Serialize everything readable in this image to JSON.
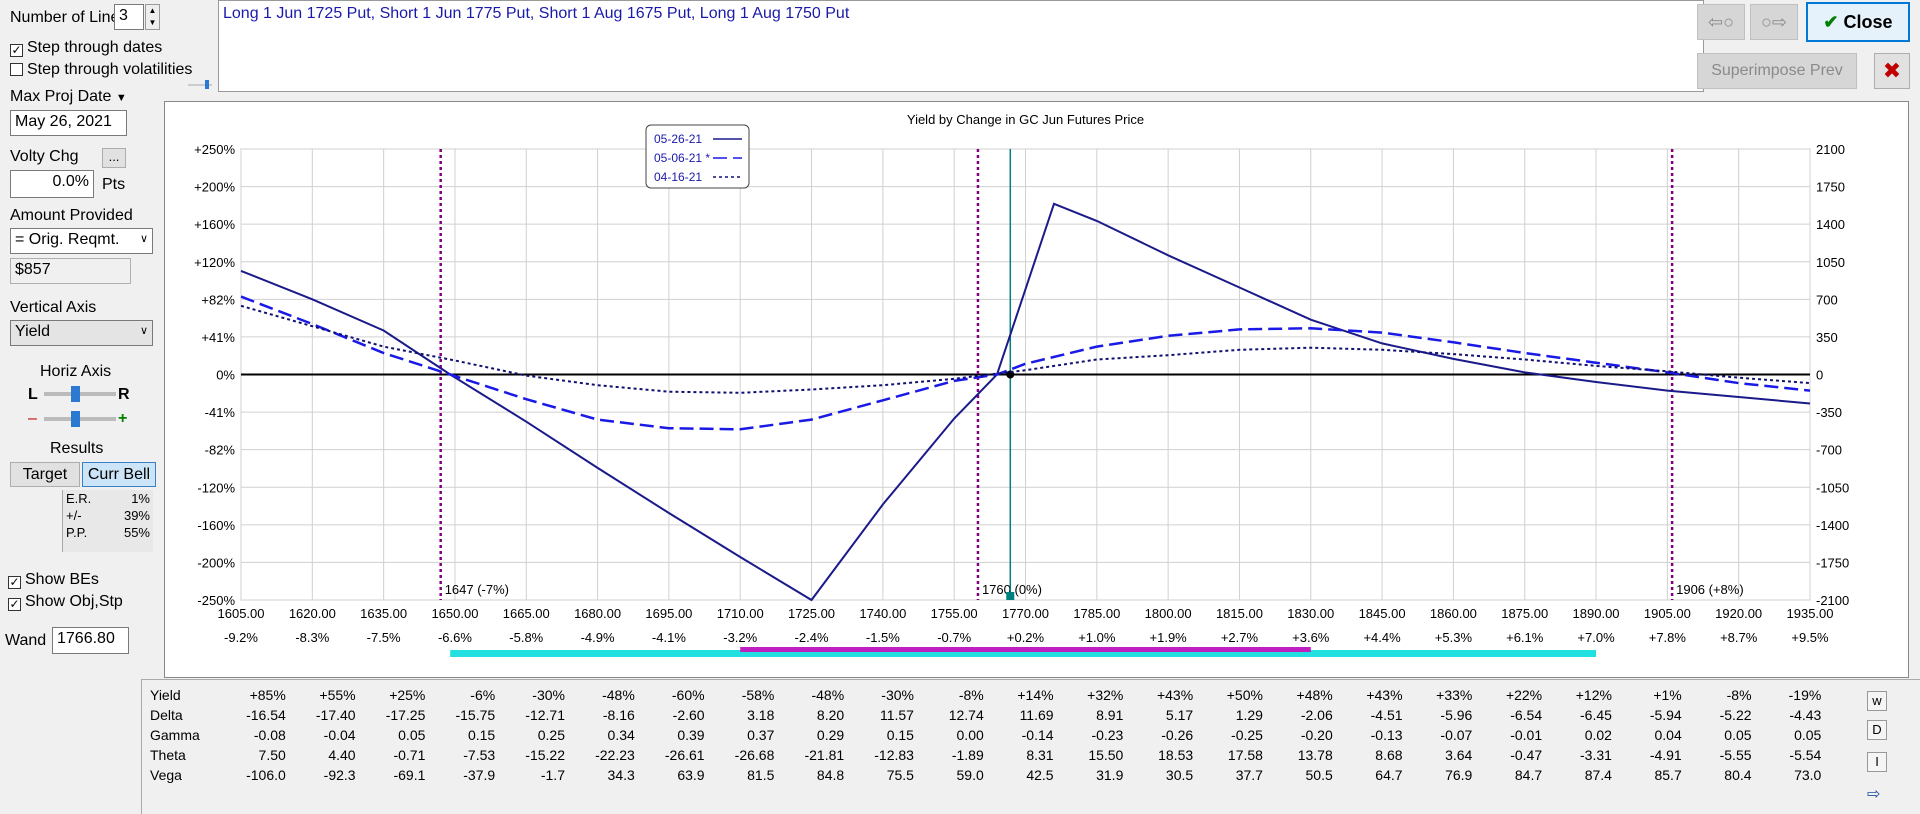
{
  "controls": {
    "number_of_lines_label": "Number of Lines",
    "number_of_lines_value": "3",
    "step_dates_label": "Step through dates",
    "step_dates_checked": true,
    "step_vol_label": "Step through volatilities",
    "step_vol_checked": false,
    "max_proj_date_label": "Max Proj Date",
    "max_proj_date_value": "May 26, 2021",
    "volty_chg_label": "Volty Chg",
    "volty_chg_value": "0.0%",
    "volty_chg_unit": "Pts",
    "ellipsis_label": "...",
    "amount_provided_label": "Amount Provided",
    "amount_provided_value": "= Orig. Reqmt.",
    "amount_value": "$857",
    "vertical_axis_label": "Vertical Axis",
    "vertical_axis_value": "Yield",
    "horiz_axis_label": "Horiz Axis",
    "slider_left": "L",
    "slider_right": "R",
    "slider_minus": "–",
    "slider_plus": "+",
    "results_label": "Results",
    "target_label": "Target",
    "curr_bell_label": "Curr Bell",
    "stats": [
      {
        "name": "E.R.",
        "value": "1%"
      },
      {
        "name": "+/-",
        "value": "39%"
      },
      {
        "name": "P.P.",
        "value": "55%"
      }
    ],
    "show_bes_label": "Show BEs",
    "show_bes_checked": true,
    "show_obj_label": "Show Obj,Stp",
    "show_obj_checked": true,
    "wand_label": "Wand",
    "wand_value": "1766.80"
  },
  "description": "Long 1 Jun 1725 Put, Short 1 Jun 1775 Put, Short 1 Aug 1675 Put, Long 1 Aug 1750 Put",
  "buttons": {
    "back_icon": "⇦○",
    "fwd_icon": "○⇨",
    "close_label": "Close",
    "close_icon": "✔",
    "superimpose_label": "Superimpose Prev",
    "x_icon": "✖"
  },
  "colors": {
    "line_solid": "#1a1a8a",
    "line_dash": "#1a1ae6",
    "line_dot": "#101070",
    "vline": "#800080",
    "wand": "#008080",
    "bar_cyan": "#22e0e0",
    "bar_magenta": "#c020c0"
  },
  "chart_data": {
    "type": "line",
    "title": "Yield by Change in GC Jun Futures Price",
    "x_ticks": [
      "1605.00",
      "1620.00",
      "1635.00",
      "1650.00",
      "1665.00",
      "1680.00",
      "1695.00",
      "1710.00",
      "1725.00",
      "1740.00",
      "1755.00",
      "1770.00",
      "1785.00",
      "1800.00",
      "1815.00",
      "1830.00",
      "1845.00",
      "1860.00",
      "1875.00",
      "1890.00",
      "1905.00",
      "1920.00",
      "1935.00"
    ],
    "x_pct_ticks": [
      "-9.2%",
      "-8.3%",
      "-7.5%",
      "-6.6%",
      "-5.8%",
      "-4.9%",
      "-4.1%",
      "-3.2%",
      "-2.4%",
      "-1.5%",
      "-0.7%",
      "+0.2%",
      "+1.0%",
      "+1.9%",
      "+2.7%",
      "+3.6%",
      "+4.4%",
      "+5.3%",
      "+6.1%",
      "+7.0%",
      "+7.8%",
      "+8.7%",
      "+9.5%"
    ],
    "y_left_ticks": [
      "+250%",
      "+200%",
      "+160%",
      "+120%",
      "+82%",
      "+41%",
      "0%",
      "-41%",
      "-82%",
      "-120%",
      "-160%",
      "-200%",
      "-250%"
    ],
    "y_right_ticks": [
      "2100",
      "1750",
      "1400",
      "1050",
      "700",
      "350",
      "0",
      "-350",
      "-700",
      "-1050",
      "-1400",
      "-1750",
      "-2100"
    ],
    "xlim": [
      1605,
      1935
    ],
    "ylim": [
      -2100,
      2100
    ],
    "legend_position": "top-left",
    "series": [
      {
        "name": "05-26-21",
        "style": "solid",
        "points": [
          [
            1605,
            965
          ],
          [
            1620,
            700
          ],
          [
            1635,
            410
          ],
          [
            1649,
            0
          ],
          [
            1665,
            -440
          ],
          [
            1680,
            -870
          ],
          [
            1695,
            -1290
          ],
          [
            1710,
            -1700
          ],
          [
            1725,
            -2100
          ],
          [
            1740,
            -1210
          ],
          [
            1755,
            -410
          ],
          [
            1764,
            0
          ],
          [
            1776,
            1590
          ],
          [
            1785,
            1430
          ],
          [
            1800,
            1110
          ],
          [
            1815,
            810
          ],
          [
            1830,
            510
          ],
          [
            1845,
            290
          ],
          [
            1860,
            145
          ],
          [
            1875,
            20
          ],
          [
            1890,
            -70
          ],
          [
            1905,
            -150
          ],
          [
            1920,
            -210
          ],
          [
            1935,
            -270
          ]
        ]
      },
      {
        "name": "05-06-21 *",
        "style": "dashed",
        "points": [
          [
            1605,
            725
          ],
          [
            1620,
            470
          ],
          [
            1635,
            200
          ],
          [
            1649,
            0
          ],
          [
            1665,
            -230
          ],
          [
            1680,
            -420
          ],
          [
            1695,
            -500
          ],
          [
            1710,
            -510
          ],
          [
            1725,
            -420
          ],
          [
            1740,
            -240
          ],
          [
            1755,
            -60
          ],
          [
            1764,
            0
          ],
          [
            1770,
            100
          ],
          [
            1785,
            260
          ],
          [
            1800,
            360
          ],
          [
            1815,
            420
          ],
          [
            1830,
            430
          ],
          [
            1845,
            390
          ],
          [
            1860,
            300
          ],
          [
            1875,
            200
          ],
          [
            1890,
            110
          ],
          [
            1905,
            20
          ],
          [
            1920,
            -80
          ],
          [
            1935,
            -150
          ]
        ]
      },
      {
        "name": "04-16-21",
        "style": "dotted",
        "points": [
          [
            1605,
            640
          ],
          [
            1620,
            450
          ],
          [
            1635,
            260
          ],
          [
            1650,
            130
          ],
          [
            1665,
            -10
          ],
          [
            1680,
            -100
          ],
          [
            1695,
            -160
          ],
          [
            1710,
            -170
          ],
          [
            1725,
            -140
          ],
          [
            1740,
            -100
          ],
          [
            1755,
            -40
          ],
          [
            1770,
            40
          ],
          [
            1785,
            140
          ],
          [
            1800,
            180
          ],
          [
            1815,
            230
          ],
          [
            1830,
            250
          ],
          [
            1845,
            230
          ],
          [
            1860,
            190
          ],
          [
            1875,
            140
          ],
          [
            1890,
            80
          ],
          [
            1905,
            30
          ],
          [
            1920,
            -30
          ],
          [
            1935,
            -80
          ]
        ]
      }
    ],
    "vlines": [
      {
        "x": 1647,
        "label": "1647 (-7%)"
      },
      {
        "x": 1760,
        "label": "1760 (0%)"
      },
      {
        "x": 1906,
        "label": "1906 (+8%)"
      }
    ],
    "wand_x": 1766.8,
    "cyan_bar_range": [
      1649,
      1890
    ],
    "magenta_bar_range": [
      1710,
      1830
    ]
  },
  "table": {
    "row_labels": [
      "Yield",
      "Delta",
      "Gamma",
      "Theta",
      "Vega"
    ],
    "rows": [
      [
        "+85%",
        "+55%",
        "+25%",
        "-6%",
        "-30%",
        "-48%",
        "-60%",
        "-58%",
        "-48%",
        "-30%",
        "-8%",
        "+14%",
        "+32%",
        "+43%",
        "+50%",
        "+48%",
        "+43%",
        "+33%",
        "+22%",
        "+12%",
        "+1%",
        "-8%",
        "-19%"
      ],
      [
        "-16.54",
        "-17.40",
        "-17.25",
        "-15.75",
        "-12.71",
        "-8.16",
        "-2.60",
        "3.18",
        "8.20",
        "11.57",
        "12.74",
        "11.69",
        "8.91",
        "5.17",
        "1.29",
        "-2.06",
        "-4.51",
        "-5.96",
        "-6.54",
        "-6.45",
        "-5.94",
        "-5.22",
        "-4.43"
      ],
      [
        "-0.08",
        "-0.04",
        "0.05",
        "0.15",
        "0.25",
        "0.34",
        "0.39",
        "0.37",
        "0.29",
        "0.15",
        "0.00",
        "-0.14",
        "-0.23",
        "-0.26",
        "-0.25",
        "-0.20",
        "-0.13",
        "-0.07",
        "-0.01",
        "0.02",
        "0.04",
        "0.05",
        "0.05"
      ],
      [
        "7.50",
        "4.40",
        "-0.71",
        "-7.53",
        "-15.22",
        "-22.23",
        "-26.61",
        "-26.68",
        "-21.81",
        "-12.83",
        "-1.89",
        "8.31",
        "15.50",
        "18.53",
        "17.58",
        "13.78",
        "8.68",
        "3.64",
        "-0.47",
        "-3.31",
        "-4.91",
        "-5.55",
        "-5.54"
      ],
      [
        "-106.0",
        "-92.3",
        "-69.1",
        "-37.9",
        "-1.7",
        "34.3",
        "63.9",
        "81.5",
        "84.8",
        "75.5",
        "59.0",
        "42.5",
        "31.9",
        "30.5",
        "37.7",
        "50.5",
        "64.7",
        "76.9",
        "84.7",
        "87.4",
        "85.7",
        "80.4",
        "73.0"
      ]
    ]
  },
  "side_icons": [
    "w",
    "D",
    "I",
    "⇨"
  ]
}
